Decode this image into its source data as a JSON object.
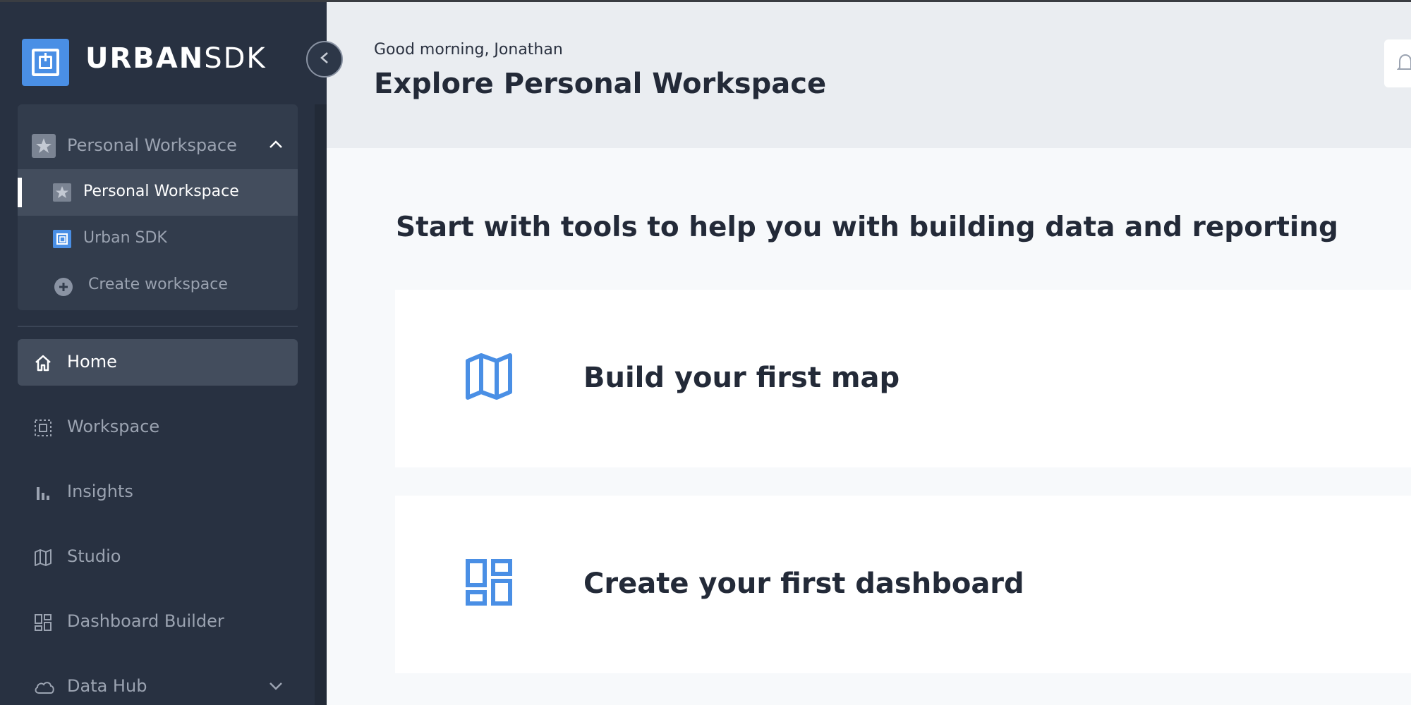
{
  "brand": {
    "name_bold": "URBAN",
    "name_light": "SDK"
  },
  "workspace_switcher": {
    "current_label": "Personal Workspace",
    "items": [
      {
        "label": "Personal Workspace",
        "active": true
      },
      {
        "label": "Urban SDK",
        "active": false
      },
      {
        "label": "Create workspace",
        "active": false
      }
    ]
  },
  "nav": {
    "items": [
      {
        "label": "Home",
        "icon": "home-icon",
        "active": true
      },
      {
        "label": "Workspace",
        "icon": "workspace-icon",
        "active": false
      },
      {
        "label": "Insights",
        "icon": "insights-icon",
        "active": false
      },
      {
        "label": "Studio",
        "icon": "map-icon",
        "active": false
      },
      {
        "label": "Dashboard Builder",
        "icon": "dashboard-icon",
        "active": false
      },
      {
        "label": "Data Hub",
        "icon": "cloud-icon",
        "active": false
      }
    ]
  },
  "header": {
    "greeting": "Good morning, Jonathan",
    "title": "Explore Personal Workspace"
  },
  "main": {
    "section_title": "Start with tools to help you with building data and reporting",
    "cards": [
      {
        "label": "Build your first map",
        "icon": "map-icon"
      },
      {
        "label": "Create your first dashboard",
        "icon": "dashboard-icon"
      }
    ]
  },
  "colors": {
    "sidebar_bg": "#283141",
    "accent": "#4a8fe5",
    "text_dark": "#232a38"
  }
}
